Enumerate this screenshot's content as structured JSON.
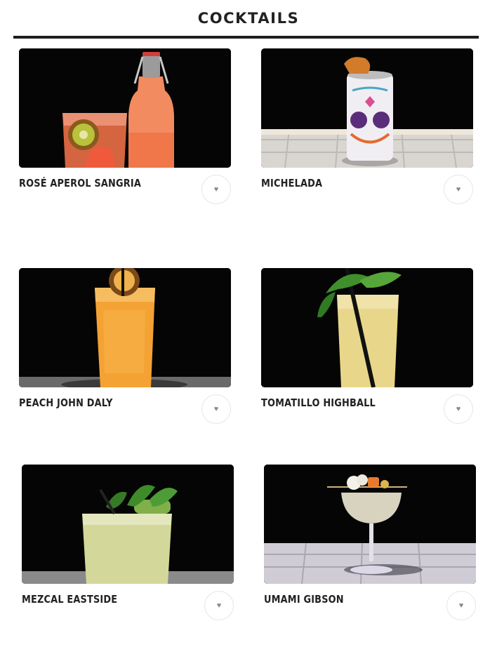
{
  "header": {
    "title": "COCKTAILS"
  },
  "cocktails": [
    {
      "name": "ROSÉ APEROL SANGRIA"
    },
    {
      "name": "MICHELADA"
    },
    {
      "name": "PEACH JOHN DALY"
    },
    {
      "name": "TOMATILLO HIGHBALL"
    },
    {
      "name": "MEZCAL EASTSIDE"
    },
    {
      "name": "UMAMI GIBSON"
    }
  ],
  "icons": {
    "favorite": "heart-icon",
    "favorite_glyph": "♥"
  }
}
